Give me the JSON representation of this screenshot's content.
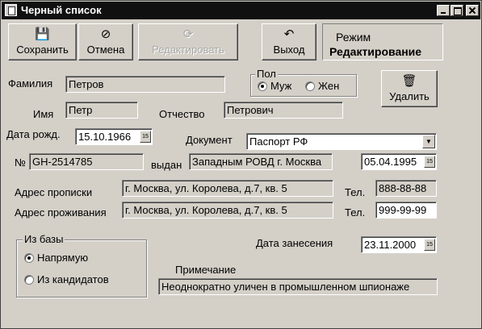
{
  "window": {
    "title": "Черный список"
  },
  "toolbar": {
    "save_label": "Сохранить",
    "cancel_label": "Отмена",
    "edit_label": "Редактировать",
    "exit_label": "Выход",
    "save_icon": "floppy-icon",
    "cancel_icon": "no-entry-icon",
    "edit_icon": "refresh-icon",
    "exit_icon": "exit-arrow-icon"
  },
  "mode": {
    "label": "Режим",
    "value": "Редактирование"
  },
  "gender": {
    "title": "Пол",
    "male": "Муж",
    "female": "Жен",
    "selected": "Муж"
  },
  "delete_label": "Удалить",
  "person": {
    "surname_label": "Фамилия",
    "surname": "Петров",
    "name_label": "Имя",
    "name": "Петр",
    "patronymic_label": "Отчество",
    "patronymic": "Петрович",
    "birth_label": "Дата рожд.",
    "birth": "15.10.1966"
  },
  "document": {
    "label": "Документ",
    "type": "Паспорт РФ",
    "number_label": "№",
    "number": "GH-2514785",
    "issued_label": "выдан",
    "issued_by": "Западным РОВД г. Москва",
    "issue_date": "05.04.1995"
  },
  "address": {
    "registration_label": "Адрес прописки",
    "registration": "г. Москва, ул. Королева, д.7, кв. 5",
    "residence_label": "Адрес проживания",
    "residence": "г. Москва, ул. Королева, д.7, кв. 5",
    "phone_label": "Тел.",
    "phone1": "888-88-88",
    "phone2": "999-99-99"
  },
  "source": {
    "title": "Из базы",
    "direct": "Напрямую",
    "candidates": "Из кандидатов",
    "selected": "Напрямую"
  },
  "entry": {
    "date_label": "Дата занесения",
    "date": "23.11.2000"
  },
  "note": {
    "label": "Примечание",
    "text": "Неоднократно уличен в промышленном шпионаже"
  },
  "calendar_icon_text": "15"
}
